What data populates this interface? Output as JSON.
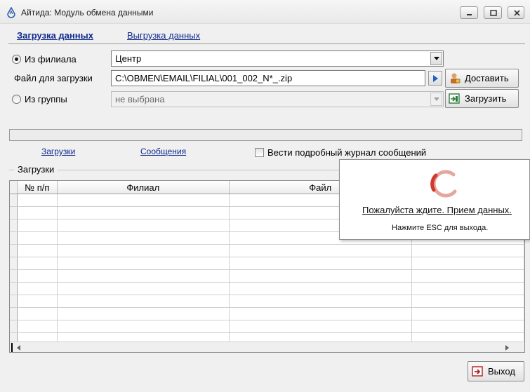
{
  "window": {
    "title": "Айтида: Модуль обмена данными",
    "icon": "app-drop-icon"
  },
  "tabs": [
    {
      "label": "Загрузка данных",
      "active": true
    },
    {
      "label": "Выгрузка данных",
      "active": false
    }
  ],
  "source": {
    "branch_radio_label": "Из филиала",
    "branch_selected": true,
    "branch_value": "Центр",
    "file_label": "Файл для загрузки",
    "file_value": "C:\\OBMEN\\EMAIL\\FILIAL\\001_002_N*_.zip",
    "group_radio_label": "Из группы",
    "group_selected": false,
    "group_value": "не выбрана"
  },
  "buttons": {
    "deliver": "Доставить",
    "load": "Загрузить",
    "exit": "Выход"
  },
  "links": {
    "loads": "Загрузки",
    "messages": "Сообщения"
  },
  "verbose_log": {
    "label": "Вести подробный журнал сообщений",
    "checked": false
  },
  "group_title": "Загрузки",
  "table": {
    "columns": [
      "№ п/п",
      "Филиал",
      "Файл"
    ],
    "empty_rows": 12
  },
  "popup": {
    "message": "Пожалуйста ждите. Прием данных.",
    "hint": "Нажмите ESC для выхода."
  },
  "colors": {
    "link": "#0f2a8c",
    "spinner": "#d03a2a",
    "window_bg": "#f0f0f0"
  }
}
